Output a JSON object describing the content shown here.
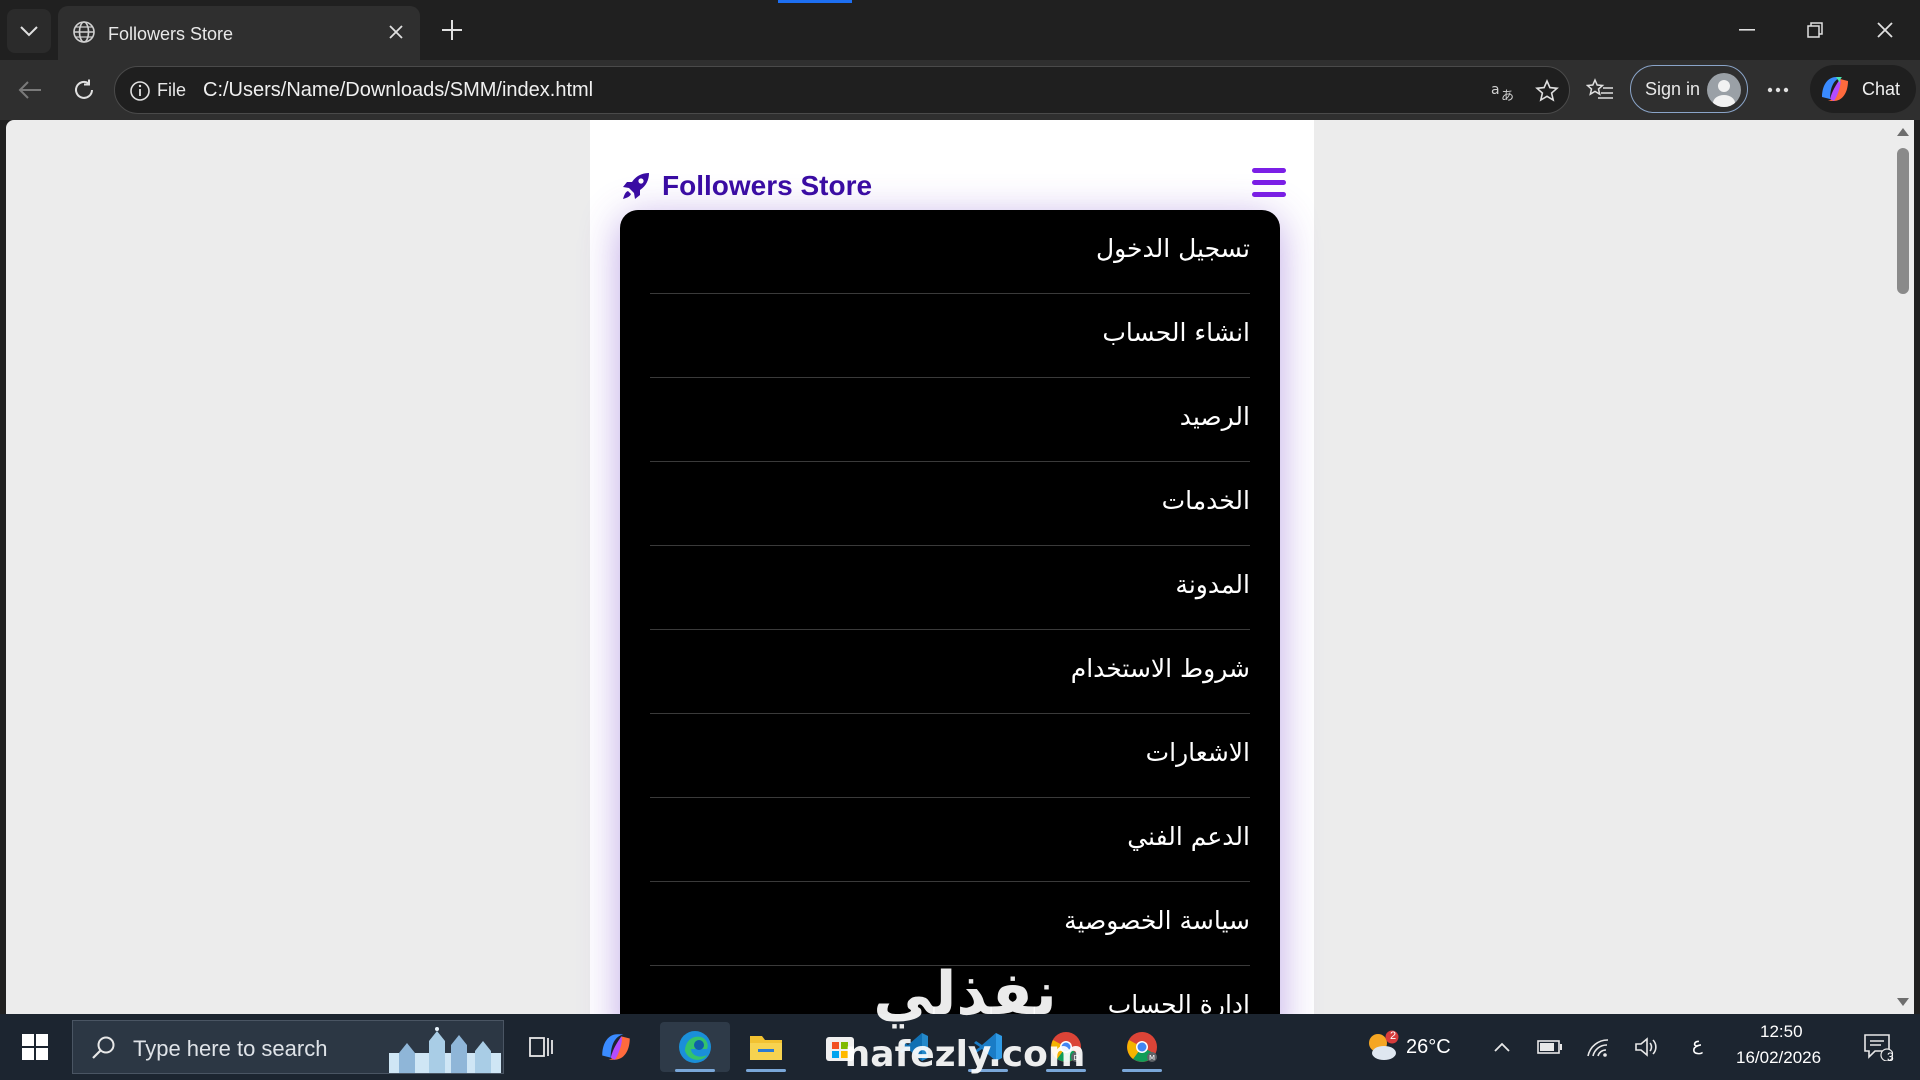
{
  "browser": {
    "tab_title": "Followers Store",
    "address": {
      "scheme": "File",
      "url": "C:/Users/Name/Downloads/SMM/index.html"
    },
    "sign_in_label": "Sign in",
    "chat_label": "Chat"
  },
  "page": {
    "brand": "Followers Store",
    "menu_items": [
      {
        "label": "تسجيل الدخول"
      },
      {
        "label": "انشاء الحساب"
      },
      {
        "label": "الرصيد"
      },
      {
        "label": "الخدمات"
      },
      {
        "label": "المدونة"
      },
      {
        "label": "شروط الاستخدام"
      },
      {
        "label": "الاشعارات"
      },
      {
        "label": "الدعم الفني"
      },
      {
        "label": "سياسة الخصوصية"
      },
      {
        "label": "إدارة الحساب"
      }
    ],
    "colors": {
      "brand": "#3a0ca3",
      "hamburger": "#7b1fe6",
      "menu_bg": "#000000"
    }
  },
  "taskbar": {
    "search_placeholder": "Type here to search",
    "weather": "26°C",
    "weather_badge": "2",
    "language": "ع",
    "time": "12:50",
    "date": "16/02/2026",
    "notifications": "3"
  },
  "watermark": {
    "arabic": "نفذلي",
    "latin": "nafezly.com"
  }
}
